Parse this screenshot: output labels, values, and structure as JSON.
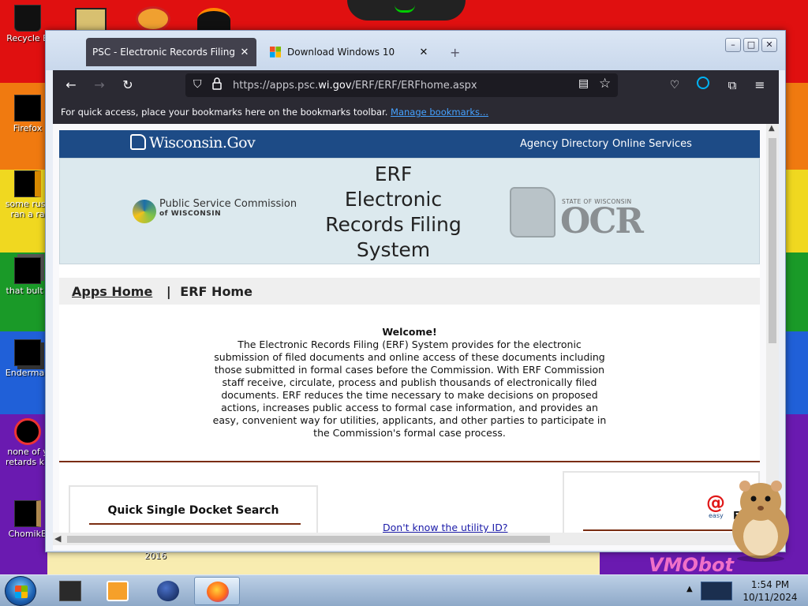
{
  "desktop": {
    "icons": [
      {
        "label": "Recycle B"
      },
      {
        "label": "Firefox"
      },
      {
        "label": "some russ"
      },
      {
        "label": "ran a ra"
      },
      {
        "label": "that bult t"
      },
      {
        "label": "Enderman"
      },
      {
        "label": "none of y"
      },
      {
        "label": "retards kn"
      },
      {
        "label": "ChomikB"
      }
    ],
    "wallpaper_text": "VMObot",
    "wallpaper_year": "2016"
  },
  "browser": {
    "tabs": [
      {
        "title": "PSC - Electronic Records Filing (ERF)",
        "active": true
      },
      {
        "title": "Download Windows 10",
        "active": false
      }
    ],
    "new_tab_symbol": "+",
    "url_prefix": "https://apps.psc.",
    "url_host": "wi.gov",
    "url_path": "/ERF/ERF/ERFhome.aspx",
    "bookmarks_text": "For quick access, place your bookmarks here on the bookmarks toolbar.",
    "bookmarks_link": "Manage bookmarks..."
  },
  "page": {
    "wigov_logo": "Wisconsin.Gov",
    "nav_links": [
      "Agency Directory",
      "Online Services"
    ],
    "psc_name": "Public Service Commission",
    "psc_of": "of WISCONSIN",
    "erf_title": [
      "ERF",
      "Electronic",
      "Records Filing",
      "System"
    ],
    "ocr_state": "STATE OF WISCONSIN",
    "ocr_text": "OCR",
    "breadcrumb_apps": "Apps Home",
    "breadcrumb_sep": "|",
    "breadcrumb_erf": "ERF Home",
    "welcome_title": "Welcome!",
    "welcome_body": "The Electronic Records Filing (ERF) System provides for the electronic submission of filed documents and online access of these documents including those submitted in formal cases before the Commission. With ERF Commission staff receive, circulate, process and publish thousands of electronically filed documents. ERF reduces the time necessary to make decisions on proposed actions, increases public access to formal case information, and provides an easy, convenient way for utilities, applicants, and other parties to participate in the Commission's formal case process.",
    "quick_search_title": "Quick Single Docket Search",
    "utility_link": "Don't know the utility ID?",
    "easy_logo_at": "@",
    "easy_logo_word": "easy",
    "right_box_title": "ERF"
  },
  "taskbar": {
    "time": "1:54 PM",
    "date": "10/11/2024"
  },
  "colors": {
    "wigov_blue": "#1d4b86",
    "banner_bg": "#dce9ee",
    "rule_brown": "#7a2d12",
    "firefox_dark": "#2b2a33"
  }
}
